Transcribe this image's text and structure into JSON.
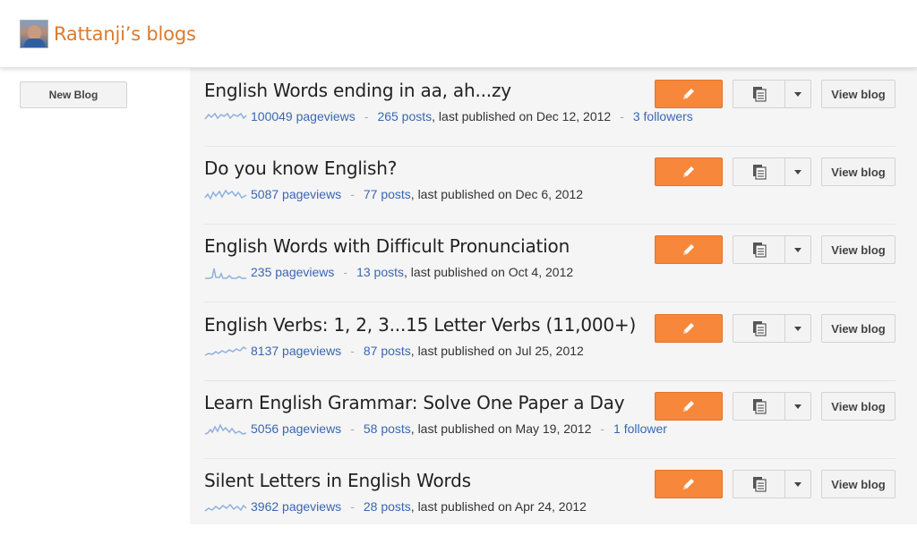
{
  "header": {
    "title": "Rattanji’s blogs"
  },
  "sidebar": {
    "new_blog_label": "New Blog"
  },
  "accent": {
    "edit_button": "#f7883b",
    "title": "#dd7a2c",
    "link": "#3a67b0"
  },
  "blogs": [
    {
      "title": "English Words ending in aa, ah...zy",
      "pageviews": "100049 pageviews",
      "posts": "265 posts",
      "published": ", last published on Dec 12, 2012",
      "followers": "3 followers"
    },
    {
      "title": "Do you know English?",
      "pageviews": "5087 pageviews",
      "posts": "77 posts",
      "published": ", last published on Dec 6, 2012"
    },
    {
      "title": "English Words with Difficult Pronunciation",
      "pageviews": "235 pageviews",
      "posts": "13 posts",
      "published": ", last published on Oct 4, 2012"
    },
    {
      "title": "English Verbs: 1, 2, 3...15 Letter Verbs (11,000+)",
      "pageviews": "8137 pageviews",
      "posts": "87 posts",
      "published": ", last published on Jul 25, 2012"
    },
    {
      "title": "Learn English Grammar: Solve One Paper a Day",
      "pageviews": "5056 pageviews",
      "posts": "58 posts",
      "published": ", last published on May 19, 2012",
      "followers": "1 follower"
    },
    {
      "title": "Silent Letters in English Words",
      "pageviews": "3962 pageviews",
      "posts": "28 posts",
      "published": ", last published on Apr 24, 2012"
    }
  ],
  "buttons": {
    "view_label": "View blog",
    "edit_icon": "pencil-icon",
    "copy_icon": "copy-pages-icon",
    "dropdown_icon": "chevron-down-icon"
  }
}
